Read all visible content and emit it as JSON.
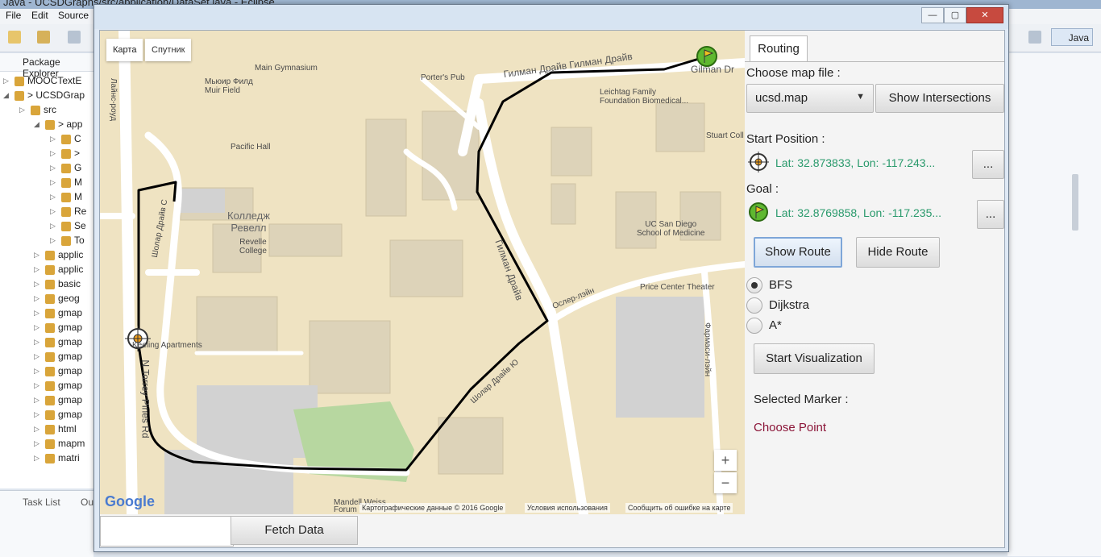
{
  "eclipse": {
    "title": "Java - UCSDGraphs/src/application/DataSet.java - Eclipse",
    "menu": [
      "File",
      "Edit",
      "Source"
    ],
    "perspective": "Java",
    "package_explorer_title": "Package Explorer",
    "tree": [
      "MOOCTextE",
      "> UCSDGrap",
      "src",
      "> app",
      "C",
      ">",
      "G",
      "M",
      "M",
      "Re",
      "Se",
      "To",
      "applic",
      "applic",
      "basic",
      "geog",
      "gmap",
      "gmap",
      "gmap",
      "gmap",
      "gmap",
      "gmap",
      "gmap",
      "gmap",
      "html",
      "mapm",
      "matri"
    ],
    "task_list": "Task List",
    "outline": "Ou"
  },
  "window": {
    "minimize": "—",
    "maximize": "▢",
    "close": "✕"
  },
  "map": {
    "type_map": "Карта",
    "type_satellite": "Спутник",
    "labels": {
      "main_gym": "Main Gymnasium",
      "porters": "Porter's Pub",
      "gilman_dr_ru": "Гилман Драйв  Гилман Драйв",
      "gilman_dr": "Gilman Dr",
      "muir_field": "Мьюир Филд\nMuir Field",
      "pacific_hall": "Pacific Hall",
      "leichtag": "Leichtag Family\nFoundation Biomedical...",
      "stuart": "Stuart Coll",
      "revelle_ru": "Колледж\nРевелл",
      "revelle": "Revelle\nCollege",
      "gilman_vert": "Гилман Драйв",
      "school_med": "UC San Diego\nSchool of Medicine",
      "osler": "Ослер-лэйн",
      "price_center": "Price Center Theater",
      "apartments": "Keeling Apartments",
      "torrey": "N Torrey Pines Rd",
      "pharmacy": "Фармаси-лэйн",
      "schollar_lower": "Шолар Драйв Ю",
      "mandeville": "Mandell Weiss\nForum",
      "roud": "Лайнс-роуд",
      "schollar_left": "Шолар Драйв С"
    },
    "attribution": [
      "Картографические данные © 2016 Google",
      "Условия использования",
      "Сообщить об ошибке на карте"
    ],
    "google": "Google",
    "zoom_in": "+",
    "zoom_out": "−"
  },
  "bottom": {
    "fetch_input_value": "",
    "fetch_button": "Fetch Data"
  },
  "panel": {
    "tab": "Routing",
    "choose_map_label": "Choose map file :",
    "map_file": "ucsd.map",
    "show_intersections": "Show Intersections",
    "start_label": "Start Position :",
    "start_value": "Lat: 32.873833, Lon: -117.243...",
    "start_browse": "...",
    "goal_label": "Goal :",
    "goal_value": "Lat: 32.8769858, Lon: -117.235...",
    "goal_browse": "...",
    "show_route": "Show Route",
    "hide_route": "Hide Route",
    "algorithms": [
      "BFS",
      "Dijkstra",
      "A*"
    ],
    "selected_algorithm": "BFS",
    "start_visualization": "Start Visualization",
    "selected_marker_label": "Selected Marker :",
    "choose_point": "Choose Point"
  },
  "colors": {
    "route": "#000000",
    "latlon": "#2a9a6c",
    "choose_point": "#8b1538",
    "map_bg": "#efe3c2"
  }
}
